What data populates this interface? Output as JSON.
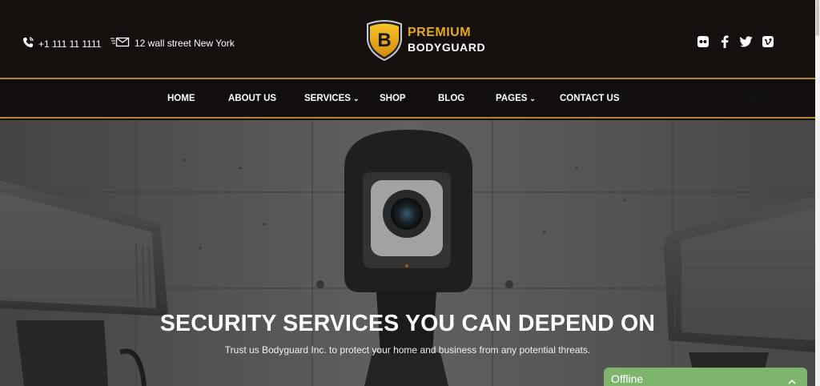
{
  "header": {
    "phone": "+1 111 11 1111",
    "address": "12 wall street New York",
    "logo_line1": "PREMIUM",
    "logo_line2": "BODYGUARD",
    "logo_letter": "B",
    "social_icons": [
      "flickr-icon",
      "facebook-icon",
      "twitter-icon",
      "vimeo-icon"
    ]
  },
  "nav": {
    "items": [
      {
        "label": "HOME",
        "dropdown": false
      },
      {
        "label": "ABOUT US",
        "dropdown": false
      },
      {
        "label": "SERVICES",
        "dropdown": true
      },
      {
        "label": "SHOP",
        "dropdown": false
      },
      {
        "label": "BLOG",
        "dropdown": false
      },
      {
        "label": "PAGES",
        "dropdown": true
      },
      {
        "label": "CONTACT US",
        "dropdown": false
      }
    ],
    "cart_icon": "cart-icon"
  },
  "hero": {
    "title": "SECURITY SERVICES YOU CAN DEPEND ON",
    "subtitle": "Trust us Bodyguard Inc. to protect your home and business from any potential threats."
  },
  "chat": {
    "status": "Offline"
  },
  "colors": {
    "accent": "#e7a81b",
    "nav_border": "#b4852b",
    "chat_bg": "#7fb46d",
    "header_bg": "#150f0e"
  }
}
